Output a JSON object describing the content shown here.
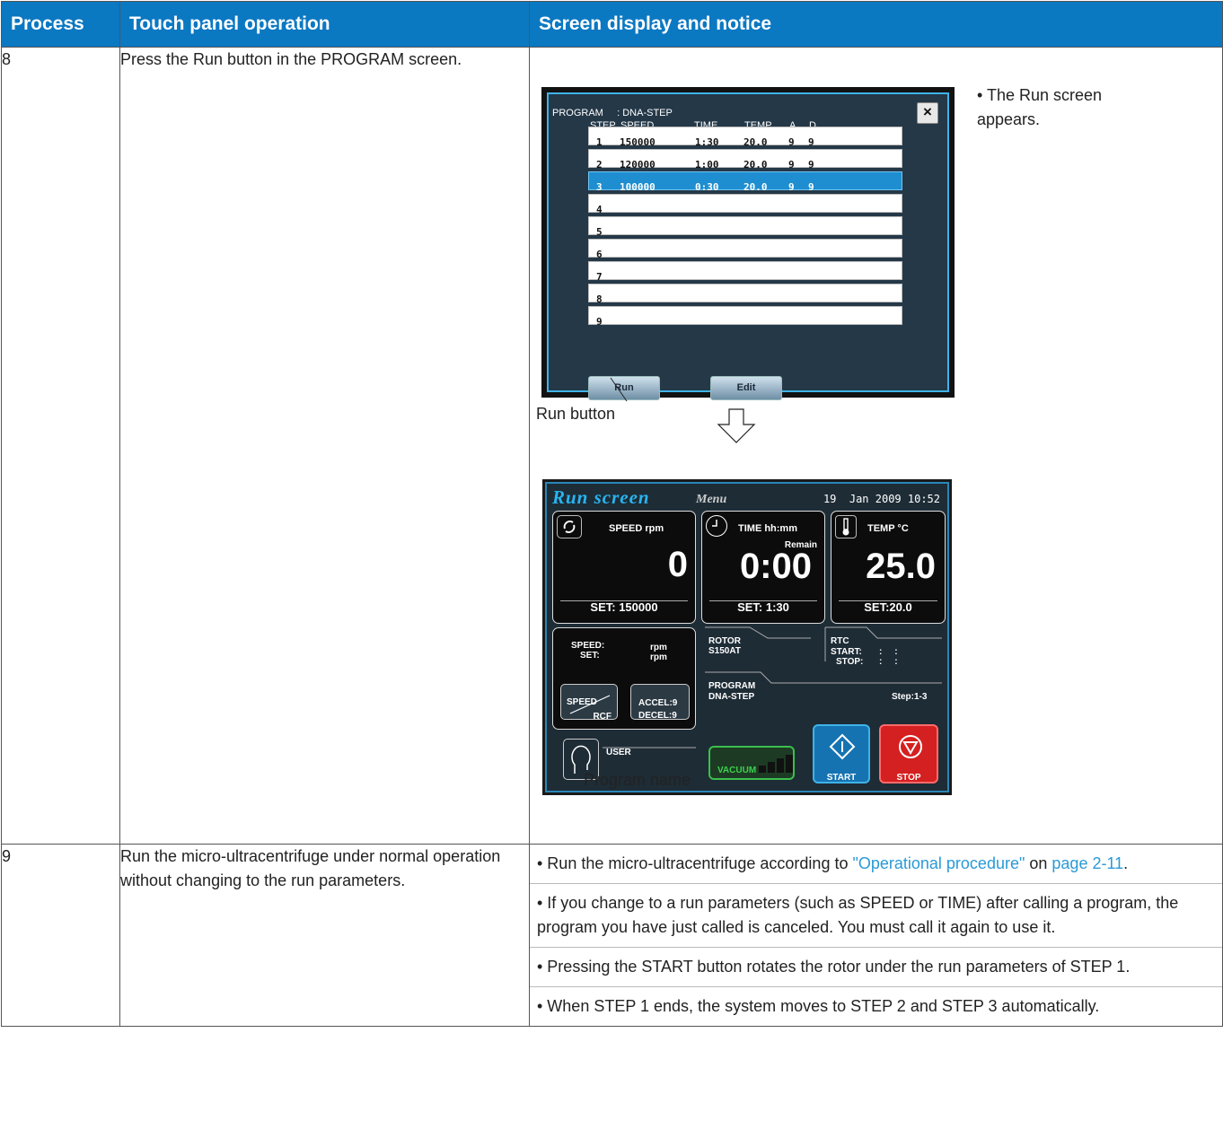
{
  "header": {
    "process": "Process",
    "operation": "Touch panel operation",
    "notice": "Screen display and notice"
  },
  "rows": [
    {
      "process": "8",
      "operation": "Press the Run button in the PROGRAM screen.",
      "notice": "• The Run screen appears."
    },
    {
      "process": "9",
      "operation": "Run the micro-ultracentrifuge under normal operation without changing to the run parameters.",
      "notices": [
        {
          "before": "• Run the micro-ultracentrifuge according to ",
          "link1": "\"Operational procedure\"",
          "middle": " on ",
          "link2": "page 2-11",
          "after": "."
        },
        {
          "text": "• If you change to a run parameters (such as SPEED or TIME) after calling a program, the program you have just called is canceled. You must call it again to use it."
        },
        {
          "text": "• Pressing the START button rotates the rotor under the run parameters of STEP 1."
        },
        {
          "text": "• When STEP 1 ends, the system moves to STEP 2 and STEP 3 automatically."
        }
      ]
    }
  ],
  "program_screen": {
    "title": "PROGRAM     : DNA-STEP",
    "close": "×",
    "columns": [
      "STEP",
      "SPEED",
      "TIME",
      "TEMP",
      "A",
      "D"
    ],
    "steps": [
      {
        "step": "1",
        "speed": "150000",
        "time": "1:30",
        "temp": "20.0",
        "a": "9",
        "d": "9"
      },
      {
        "step": "2",
        "speed": "120000",
        "time": "1:00",
        "temp": "20.0",
        "a": "9",
        "d": "9"
      },
      {
        "step": "3",
        "speed": "100000",
        "time": "0:30",
        "temp": "20.0",
        "a": "9",
        "d": "9",
        "selected": true
      },
      {
        "step": "4"
      },
      {
        "step": "5"
      },
      {
        "step": "6"
      },
      {
        "step": "7"
      },
      {
        "step": "8"
      },
      {
        "step": "9"
      }
    ],
    "run_button": "Run",
    "edit_button": "Edit"
  },
  "callouts": {
    "run_button": "Run button",
    "program_name": "Program name"
  },
  "run_screen": {
    "tab_run": "Run screen",
    "tab_menu": "Menu",
    "datetime": "19  Jan 2009 10:52",
    "speed_label": "SPEED   rpm",
    "speed_value": "0",
    "speed_set": "SET:  150000",
    "time_label": "TIME   hh:mm",
    "time_remain": "Remain",
    "time_value": "0:00",
    "time_set": "SET:  1:30",
    "temp_label": "TEMP    °C",
    "temp_value": "25.0",
    "temp_set": "SET:20.0",
    "speed_read": "SPEED:",
    "set_read": "SET:",
    "rpm1": "rpm",
    "rpm2": "rpm",
    "rotor_label": "ROTOR",
    "rotor_value": "S150AT",
    "rtc_label": "RTC",
    "rtc_start": "START:",
    "rtc_stop": "STOP:",
    "rtc_start_val": ":     :",
    "rtc_stop_val": ":     :",
    "speed_btn_top": "SPEED",
    "speed_btn_bottom": "RCF",
    "accel": "ACCEL:9",
    "decel": "DECEL:9",
    "program_label": "PROGRAM",
    "program_value": "DNA-STEP",
    "step_range": "Step:1-3",
    "user_label": "USER",
    "vacuum": "VACUUM",
    "start": "START",
    "stop": "STOP"
  }
}
